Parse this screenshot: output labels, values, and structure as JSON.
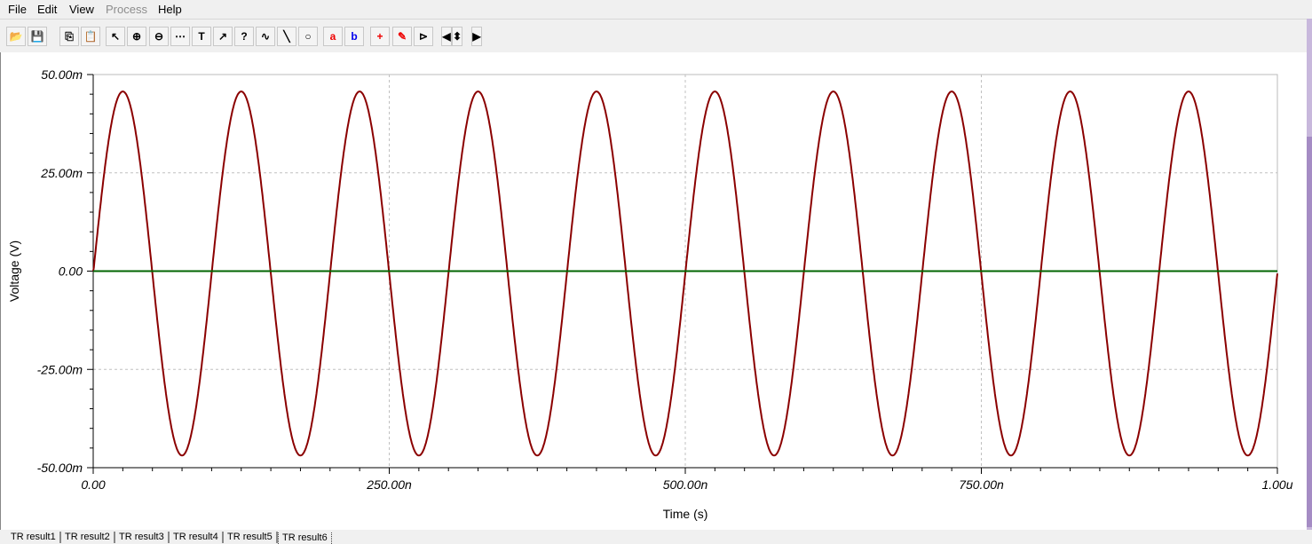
{
  "menu": [
    "File",
    "Edit",
    "View",
    "Process",
    "Help"
  ],
  "menu_disabled": [
    "Process"
  ],
  "toolbar": [
    "open-folder",
    "save",
    "copy",
    "paste-special",
    "select-arrow",
    "zoom-in",
    "zoom-100",
    "grid",
    "text",
    "label-curve",
    "label-question",
    "formula",
    "line",
    "circle",
    "cursor-a",
    "cursor-b",
    "add-curve",
    "add-probe",
    "flag",
    "scroll-left",
    "scroll-up-down",
    "scroll-right"
  ],
  "tabs": [
    "TR result1",
    "TR result2",
    "TR result3",
    "TR result4",
    "TR result5",
    "TR result6"
  ],
  "active_tab": 5,
  "chart_data": {
    "type": "line",
    "xlabel": "Time (s)",
    "ylabel": "Voltage (V)",
    "xlim": [
      0,
      1e-06
    ],
    "ylim": [
      -0.05,
      0.05
    ],
    "xticks": [
      0,
      2.5e-07,
      5e-07,
      7.5e-07,
      1e-06
    ],
    "xtick_labels": [
      "0.00",
      "250.00n",
      "500.00n",
      "750.00n",
      "1.00u"
    ],
    "yticks": [
      0.05,
      0.025,
      0,
      -0.025,
      -0.05
    ],
    "ytick_labels": [
      "50.00m",
      "25.00m",
      "0.00",
      "-25.00m",
      "-50.00m"
    ],
    "grid": true,
    "series": [
      {
        "kind": "sine",
        "amplitude": 0.0463,
        "offset": -0.0006,
        "frequency": 10000000.0,
        "phase_deg": 0,
        "color": "#8b0000"
      },
      {
        "kind": "constant",
        "value": 0,
        "color": "#006400"
      }
    ]
  }
}
